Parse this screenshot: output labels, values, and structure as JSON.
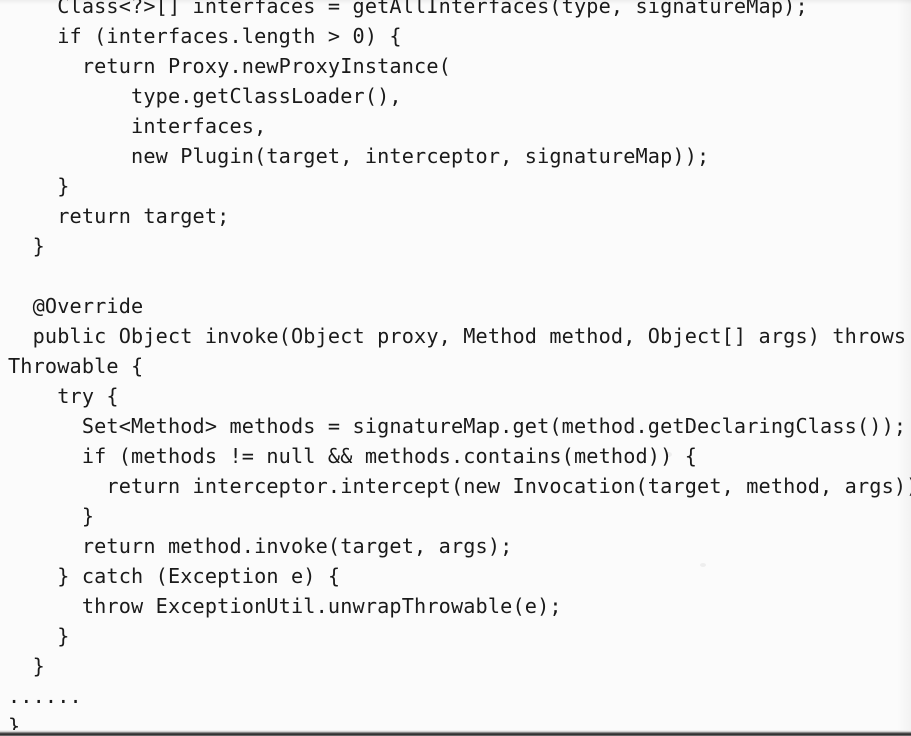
{
  "page": {
    "kind": "scanned-book-page",
    "language": "java",
    "background_color": "#fbfbfb",
    "text_color": "#1a1a1a",
    "bottom_edge_color": "#2b2b2b"
  },
  "code": {
    "lines": [
      "    Class<?>[] interfaces = getAllInterfaces(type, signatureMap);",
      "    if (interfaces.length > 0) {",
      "      return Proxy.newProxyInstance(",
      "          type.getClassLoader(),",
      "          interfaces,",
      "          new Plugin(target, interceptor, signatureMap));",
      "    }",
      "    return target;",
      "  }",
      "",
      "  @Override",
      "  public Object invoke(Object proxy, Method method, Object[] args) throws",
      "Throwable {",
      "    try {",
      "      Set<Method> methods = signatureMap.get(method.getDeclaringClass());",
      "      if (methods != null && methods.contains(method)) {",
      "        return interceptor.intercept(new Invocation(target, method, args));",
      "      }",
      "      return method.invoke(target, args);",
      "    } catch (Exception e) {",
      "      throw ExceptionUtil.unwrapThrowable(e);",
      "    }",
      "  }",
      "......",
      "}"
    ]
  }
}
